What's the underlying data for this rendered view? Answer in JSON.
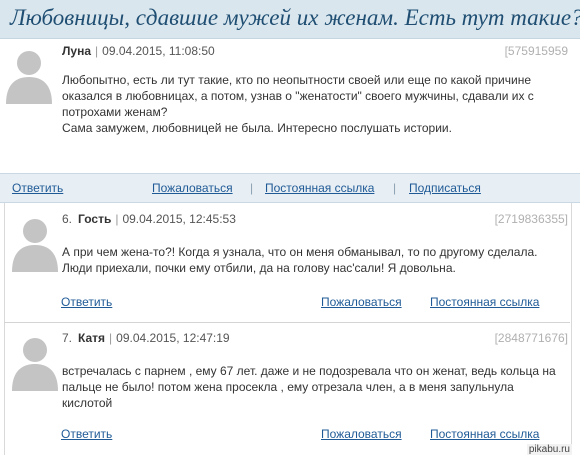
{
  "page": {
    "title": "Любовницы, сдавшие мужей их женам. Есть тут такие?"
  },
  "original_post": {
    "author": "Луна",
    "date": "09.04.2015, 11:08:50",
    "id": "[575915959",
    "paragraphs": [
      "Любопытно, есть ли тут такие, кто по неопытности своей или еще по какой причине оказался в любовницах, а потом, узнав о \"женатости\" своего мужчины, сдавали их с потрохами женам?",
      "Сама замужем, любовницей не была. Интересно послушать истории."
    ],
    "actions": {
      "reply": "Ответить",
      "complain": "Пожаловаться",
      "permalink": "Постоянная ссылка",
      "subscribe": "Подписаться"
    }
  },
  "comments": [
    {
      "number": "6.",
      "author": "Гость",
      "date": "09.04.2015, 12:45:53",
      "id": "[2719836355]",
      "text": "А при чем жена-то?! Когда я узнала, что он меня обманывал, то по другому сделала. Люди приехали, почки ему отбили, да на голову нас'сали! Я довольна.",
      "actions": {
        "reply": "Ответить",
        "complain": "Пожаловаться",
        "permalink": "Постоянная ссылка"
      }
    },
    {
      "number": "7.",
      "author": "Катя",
      "date": "09.04.2015, 12:47:19",
      "id": "[2848771676]",
      "text": "встречалась с парнем , ему 67 лет. даже и не подозревала что он женат, ведь кольца на пальце не было! потом жена просекла , ему отрезала член, а в меня запульнула кислотой",
      "actions": {
        "reply": "Ответить",
        "complain": "Пожаловаться",
        "permalink": "Постоянная ссылка"
      }
    }
  ],
  "watermark": "pikabu.ru",
  "colors": {
    "title_bar": "#d9e6ee",
    "title_text": "#1f4e72",
    "link": "#1f5a96",
    "action_bar": "#e8eff4",
    "post_id": "#b0b0b0"
  },
  "icons": {
    "avatar": "default-user-silhouette"
  }
}
